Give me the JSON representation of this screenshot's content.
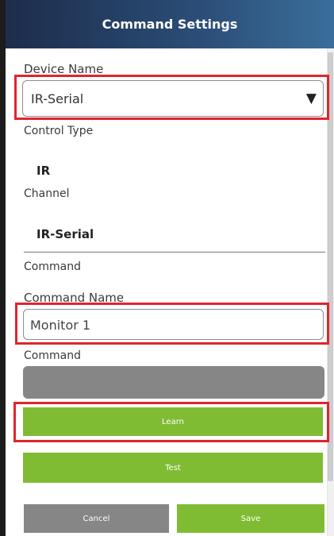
{
  "header": {
    "title": "Command Settings"
  },
  "device": {
    "label": "Device Name",
    "value": "IR-Serial"
  },
  "control_type": {
    "label": "Control Type",
    "value": "IR"
  },
  "channel": {
    "label": "Channel",
    "value": "IR-Serial"
  },
  "command_section": {
    "label": "Command"
  },
  "command_name": {
    "label": "Command Name",
    "value": "Monitor 1"
  },
  "command": {
    "label": "Command",
    "value": ""
  },
  "buttons": {
    "learn": "Learn",
    "test": "Test",
    "cancel": "Cancel",
    "save": "Save"
  },
  "colors": {
    "accent_green": "#80bc33",
    "highlight_red": "#e2242b",
    "disabled_gray": "#868686"
  },
  "icons": {
    "dropdown": "chevron-down-icon"
  }
}
